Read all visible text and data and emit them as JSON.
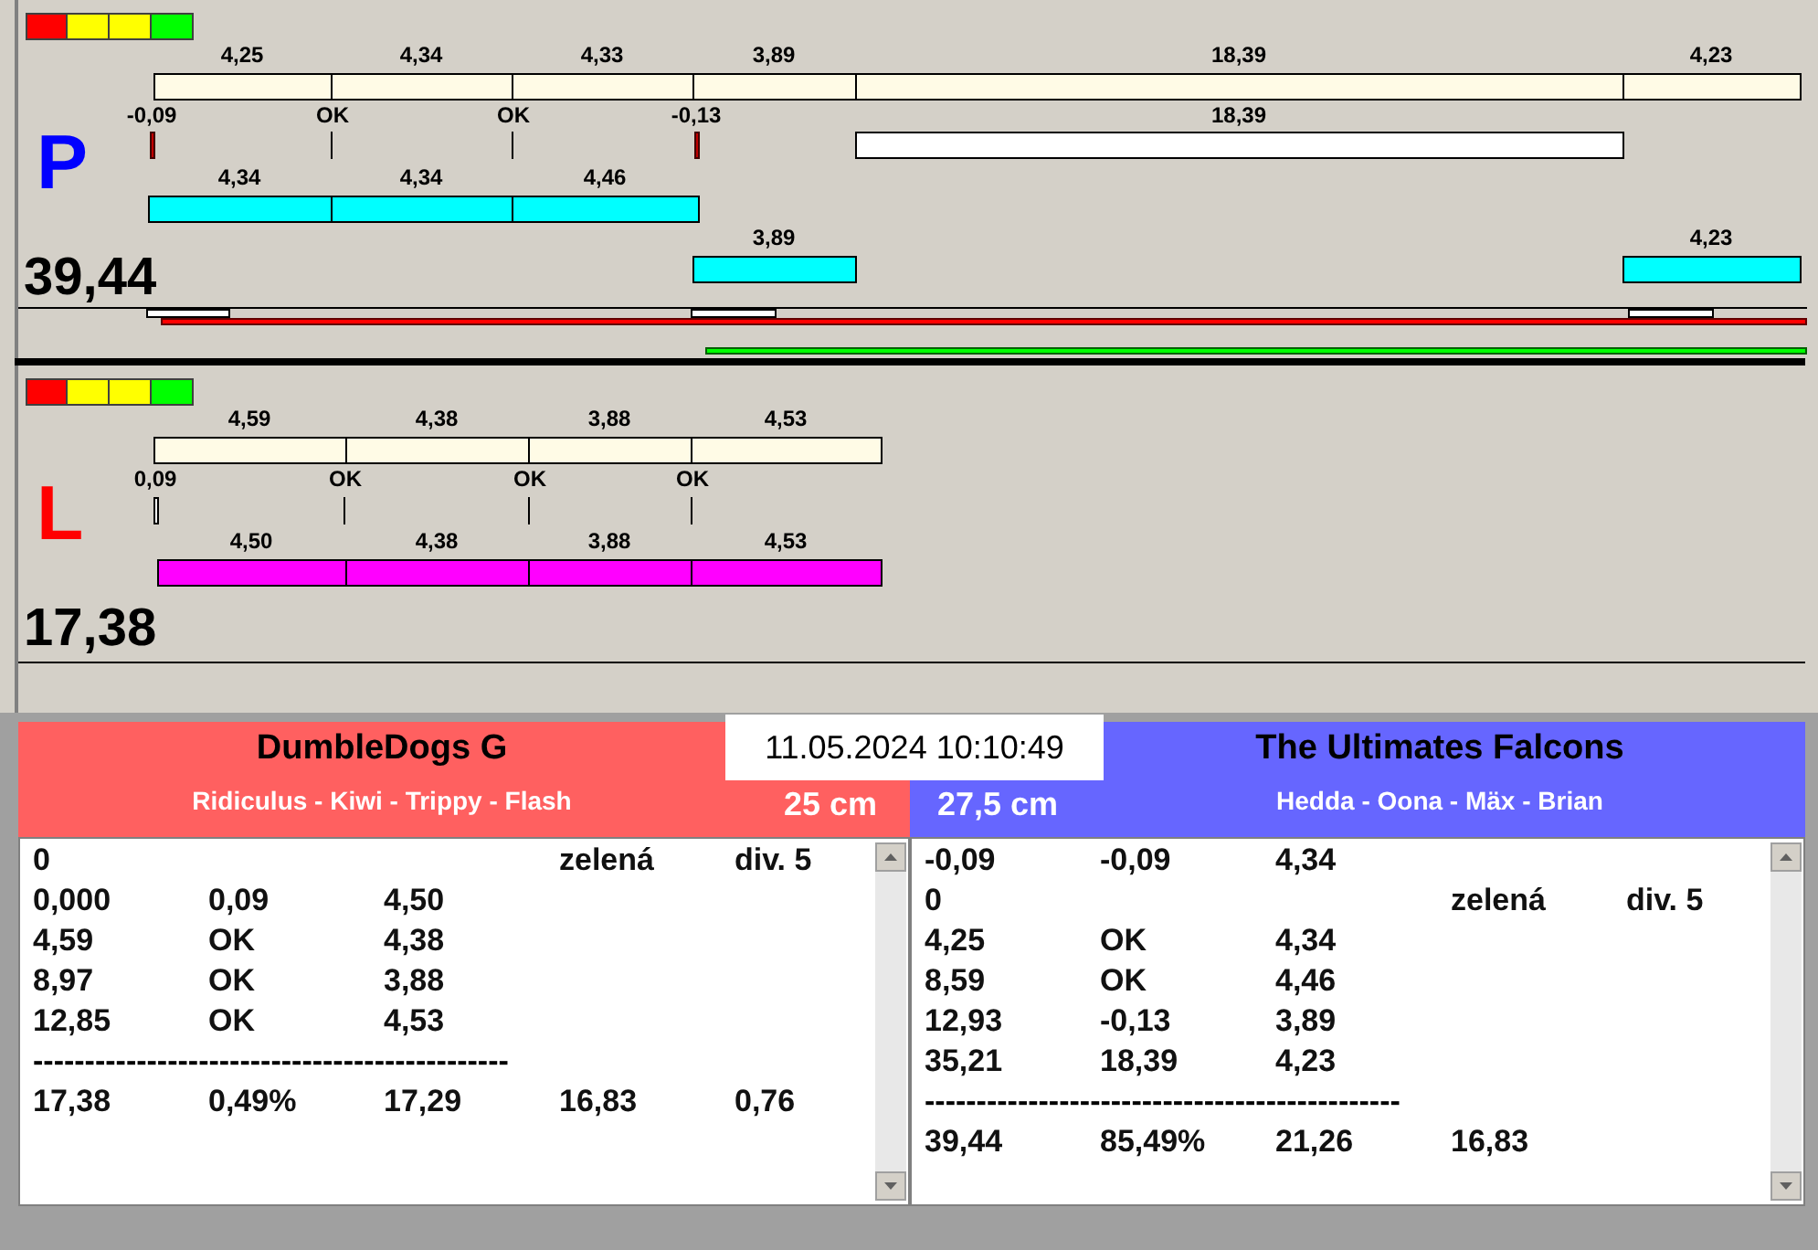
{
  "panels": [
    {
      "letter": "P",
      "color": "#0000ff",
      "total": "39,44",
      "rows": [
        {
          "kind": "bar",
          "color": "#fffbe6",
          "items": [
            {
              "label": "4,25"
            },
            {
              "label": "4,34"
            },
            {
              "label": "4,33"
            },
            {
              "label": "3,89"
            },
            {
              "label": "18,39"
            },
            {
              "label": "4,23"
            }
          ]
        },
        {
          "kind": "marks",
          "items": [
            {
              "kind": "fault",
              "label": "-0,09"
            },
            {
              "kind": "ok",
              "label": "OK"
            },
            {
              "kind": "ok",
              "label": "OK"
            },
            {
              "kind": "fault",
              "label": "-0,13"
            },
            {
              "kind": "bar",
              "label": "18,39"
            }
          ]
        },
        {
          "kind": "bar",
          "color": "#00ffff",
          "items": [
            {
              "label": "4,34"
            },
            {
              "label": "4,34"
            },
            {
              "label": "4,46"
            }
          ]
        },
        {
          "kind": "bar",
          "color": "#00ffff",
          "items": [
            {
              "label": "3,89"
            },
            {
              "label": "4,23"
            }
          ]
        }
      ]
    },
    {
      "letter": "L",
      "color": "#ff0000",
      "total": "17,38",
      "rows": [
        {
          "kind": "bar",
          "color": "#fffbe6",
          "items": [
            {
              "label": "4,59"
            },
            {
              "label": "4,38"
            },
            {
              "label": "3,88"
            },
            {
              "label": "4,53"
            }
          ]
        },
        {
          "kind": "marks",
          "items": [
            {
              "kind": "gap",
              "label": "0,09"
            },
            {
              "kind": "ok",
              "label": "OK"
            },
            {
              "kind": "ok",
              "label": "OK"
            },
            {
              "kind": "ok",
              "label": "OK"
            }
          ]
        },
        {
          "kind": "bar",
          "color": "#ff00ff",
          "items": [
            {
              "label": "4,50"
            },
            {
              "label": "4,38"
            },
            {
              "label": "3,88"
            },
            {
              "label": "4,53"
            }
          ]
        }
      ]
    }
  ],
  "datetime": "11.05.2024 10:10:49",
  "teams": [
    {
      "name": "DumbleDogs G",
      "members": "Ridiculus - Kiwi - Trippy - Flash",
      "length": "25 cm",
      "color": "#ff6060",
      "rows": [
        {
          "kind": "data",
          "column_1": "0",
          "column_4": "zelená",
          "column_5": "div. 5"
        },
        {
          "kind": "data",
          "column_1": "0,000",
          "column_2": "0,09",
          "column_3": "4,50"
        },
        {
          "kind": "data",
          "column_1": "4,59",
          "column_2": "OK",
          "column_3": "4,38"
        },
        {
          "kind": "data",
          "column_1": "8,97",
          "column_2": "OK",
          "column_3": "3,88"
        },
        {
          "kind": "data",
          "column_1": "12,85",
          "column_2": "OK",
          "column_3": "4,53"
        },
        {
          "kind": "rule",
          "text": "----------------------------------------------"
        },
        {
          "kind": "data",
          "column_1": "17,38",
          "column_2": "0,49%",
          "column_3": "17,29",
          "column_4": "16,83",
          "column_5": "0,76"
        }
      ]
    },
    {
      "name": "The Ultimates Falcons",
      "members": "Hedda - Oona - Mäx - Brian",
      "length": "27,5 cm",
      "color": "#6666ff",
      "rows": [
        {
          "kind": "data",
          "column_1": "-0,09",
          "column_2": "-0,09",
          "column_3": "4,34"
        },
        {
          "kind": "data",
          "column_1": "0",
          "column_4": "zelená",
          "column_5": "div. 5"
        },
        {
          "kind": "data",
          "column_1": "4,25",
          "column_2": "OK",
          "column_3": "4,34"
        },
        {
          "kind": "data",
          "column_1": "8,59",
          "column_2": "OK",
          "column_3": "4,46"
        },
        {
          "kind": "data",
          "column_1": "12,93",
          "column_2": "-0,13",
          "column_3": "3,89"
        },
        {
          "kind": "data",
          "column_1": "35,21",
          "column_2": "18,39",
          "column_3": "4,23"
        },
        {
          "kind": "rule",
          "text": "----------------------------------------------"
        },
        {
          "kind": "data",
          "column_1": "39,44",
          "column_2": "85,49%",
          "column_3": "21,26",
          "column_4": "16,83"
        }
      ]
    }
  ]
}
